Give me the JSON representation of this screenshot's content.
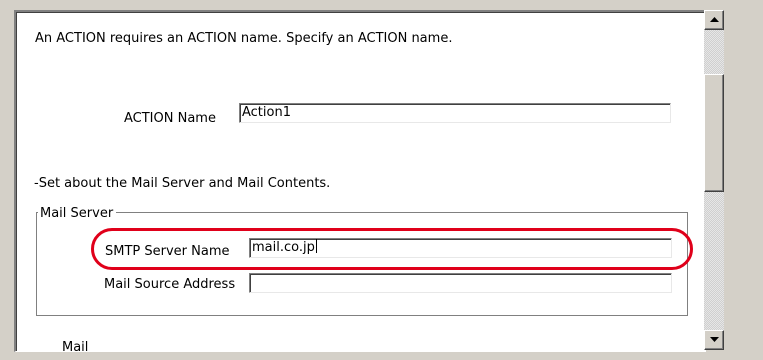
{
  "intro_text": "An ACTION requires an ACTION name. Specify an ACTION name.",
  "action": {
    "label": "ACTION Name",
    "value": "Action1"
  },
  "mail_intro_text": "-Set about the Mail Server and Mail Contents.",
  "mail_server": {
    "group_label": "Mail Server",
    "smtp_label": "SMTP Server Name",
    "smtp_value": "mail.co.jp",
    "source_label": "Mail Source Address",
    "source_value": ""
  },
  "cut_off_label": "Mail Contents",
  "highlight_color": "#e0001a",
  "scrollbar": {
    "up_icon": "triangle-up-icon",
    "down_icon": "triangle-down-icon"
  }
}
